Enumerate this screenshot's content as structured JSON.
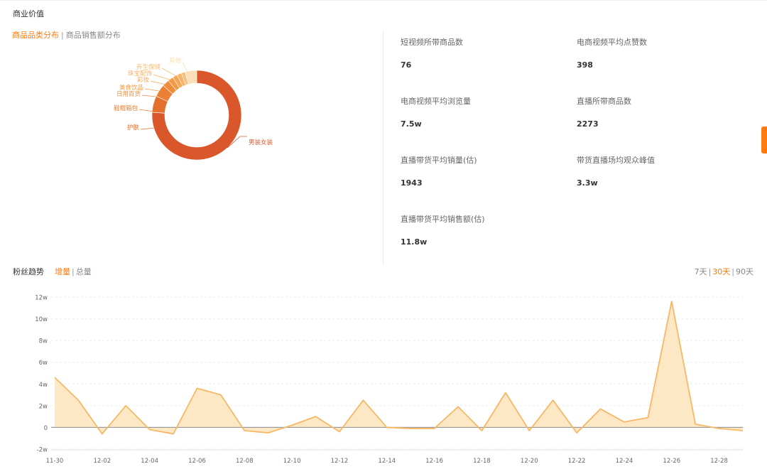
{
  "section_title": "商业价值",
  "category_tabs": [
    "商品品类分布",
    "商品销售额分布"
  ],
  "donut": {
    "type": "pie",
    "slices": [
      {
        "name": "男装女装",
        "value": 76.0,
        "color": "#d9572b"
      },
      {
        "name": "护肤",
        "value": 6.0,
        "color": "#e4702e"
      },
      {
        "name": "鞋帽箱包",
        "value": 4.5,
        "color": "#eb7f33"
      },
      {
        "name": "日用百货",
        "value": 2.5,
        "color": "#ef8c3a"
      },
      {
        "name": "美食饮品",
        "value": 2.0,
        "color": "#f29a45"
      },
      {
        "name": "彩妆",
        "value": 1.8,
        "color": "#f4a653"
      },
      {
        "name": "珠宝配饰",
        "value": 1.6,
        "color": "#f6b267"
      },
      {
        "name": "养生保健",
        "value": 1.4,
        "color": "#f8bf7e"
      },
      {
        "name": "其他",
        "value": 4.2,
        "color": "#fbdfb8"
      }
    ]
  },
  "metrics": [
    {
      "label": "短视频所带商品数",
      "value": "76"
    },
    {
      "label": "电商视频平均点赞数",
      "value": "398"
    },
    {
      "label": "电商视频平均浏览量",
      "value": "7.5w"
    },
    {
      "label": "直播所带商品数",
      "value": "2273"
    },
    {
      "label": "直播带货平均销量(估)",
      "value": "1943"
    },
    {
      "label": "带货直播场均观众峰值",
      "value": "3.3w"
    },
    {
      "label": "直播带货平均销售额(估)",
      "value": "11.8w"
    }
  ],
  "fans": {
    "title": "粉丝趋势",
    "tabs": [
      "增量",
      "总量"
    ],
    "ranges": [
      "7天",
      "30天",
      "90天"
    ]
  },
  "chart_data": {
    "type": "area",
    "x": [
      "11-30",
      "12-01",
      "12-02",
      "12-03",
      "12-04",
      "12-05",
      "12-06",
      "12-07",
      "12-08",
      "12-09",
      "12-10",
      "12-11",
      "12-12",
      "12-13",
      "12-14",
      "12-15",
      "12-16",
      "12-17",
      "12-18",
      "12-19",
      "12-20",
      "12-21",
      "12-22",
      "12-23",
      "12-24",
      "12-25",
      "12-26",
      "12-27",
      "12-28",
      "12-29"
    ],
    "x_tick_labels": [
      "11-30",
      "12-02",
      "12-04",
      "12-06",
      "12-08",
      "12-10",
      "12-12",
      "12-14",
      "12-16",
      "12-18",
      "12-20",
      "12-22",
      "12-24",
      "12-26",
      "12-28"
    ],
    "values": [
      4.6,
      2.5,
      -0.6,
      2.0,
      -0.2,
      -0.6,
      3.6,
      3.0,
      -0.3,
      -0.5,
      0.2,
      1.0,
      -0.4,
      2.5,
      0.0,
      -0.1,
      -0.1,
      1.9,
      -0.3,
      3.2,
      -0.3,
      2.5,
      -0.5,
      1.7,
      0.5,
      0.9,
      11.6,
      0.3,
      -0.1,
      -0.3
    ],
    "y_ticks": [
      -2,
      0,
      2,
      4,
      6,
      8,
      10,
      12
    ],
    "y_tick_labels": [
      "-2w",
      "0",
      "2w",
      "4w",
      "6w",
      "8w",
      "10w",
      "12w"
    ],
    "ylim": [
      -2,
      12
    ],
    "grid": true,
    "line_color": "#f7b865",
    "fill_color": "#fde6c0"
  }
}
